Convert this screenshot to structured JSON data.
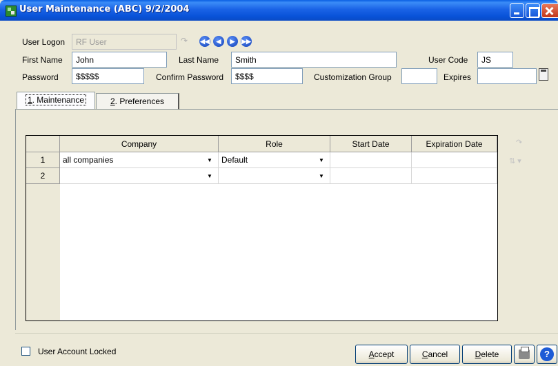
{
  "window": {
    "title": "User Maintenance (ABC) 9/2/2004",
    "icons": [
      "app-icon",
      "minimize-icon",
      "maximize-icon",
      "close-icon"
    ]
  },
  "form": {
    "user_logon_label": "User Logon",
    "user_logon_value": "RF User",
    "first_name_label": "First Name",
    "first_name_value": "John",
    "last_name_label": "Last Name",
    "last_name_value": "Smith",
    "user_code_label": "User Code",
    "user_code_value": "JS",
    "password_label": "Password",
    "password_value": "$$$$$",
    "confirm_password_label": "Confirm Password",
    "confirm_password_value": "$$$$",
    "customization_group_label": "Customization Group",
    "customization_group_value": "",
    "expires_label": "Expires",
    "expires_value": "",
    "nav_icons": [
      "first-record-icon",
      "previous-record-icon",
      "next-record-icon",
      "last-record-icon"
    ]
  },
  "tabs": [
    {
      "key": "1",
      "label": ". Maintenance"
    },
    {
      "key": "2",
      "label": ". Preferences"
    }
  ],
  "grid": {
    "columns": [
      "Company",
      "Role",
      "Start Date",
      "Expiration Date"
    ],
    "rows": [
      {
        "num": "1",
        "company": "all companies",
        "role": "Default",
        "start_date": "",
        "expiration_date": ""
      },
      {
        "num": "2",
        "company": "",
        "role": "",
        "start_date": "",
        "expiration_date": ""
      }
    ]
  },
  "footer": {
    "locked_label": "User Account Locked",
    "locked_checked": false,
    "accept_key": "A",
    "accept_rest": "ccept",
    "cancel_key": "C",
    "cancel_rest": "ancel",
    "delete_key": "D",
    "delete_rest": "elete",
    "help_glyph": "?"
  }
}
